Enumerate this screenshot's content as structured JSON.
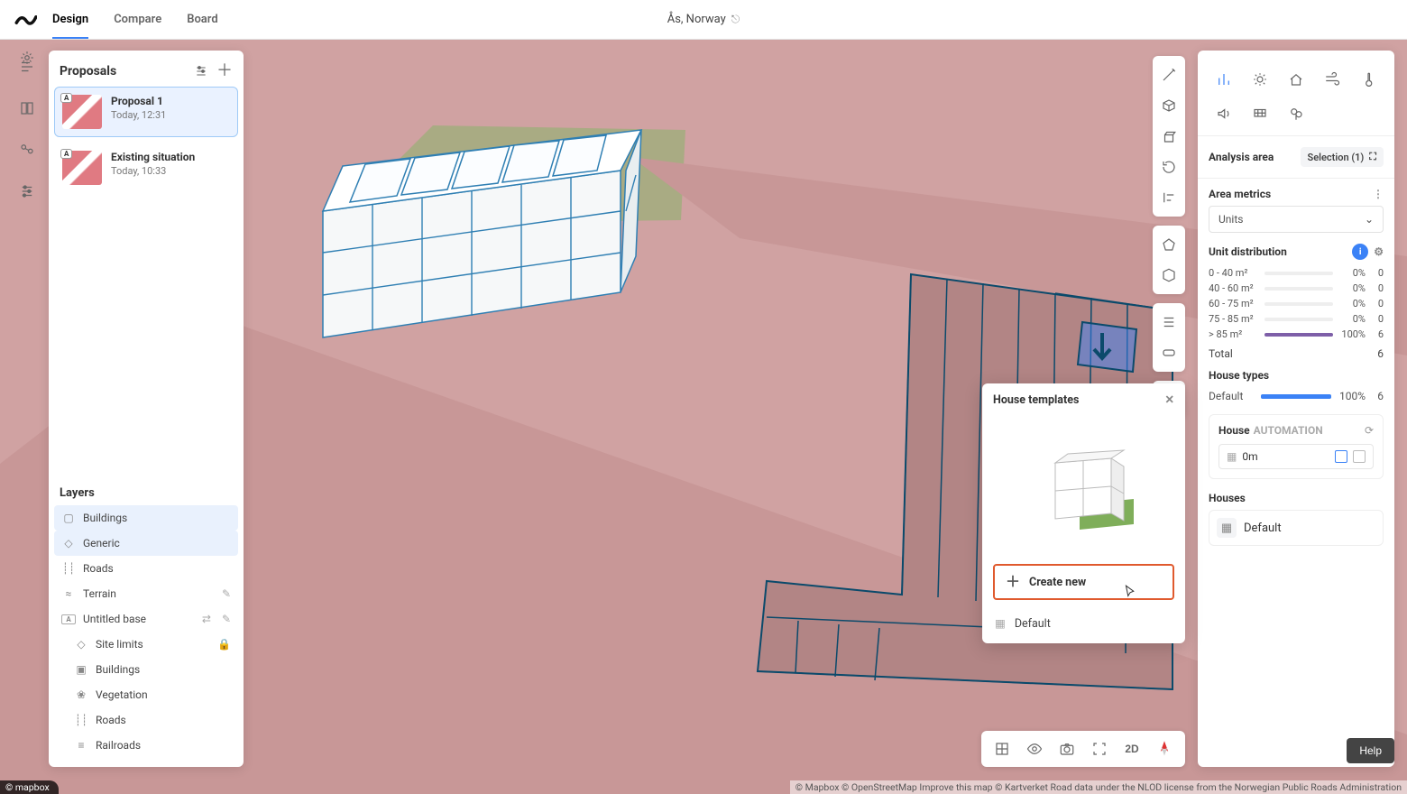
{
  "header": {
    "tabs": {
      "design": "Design",
      "compare": "Compare",
      "board": "Board"
    },
    "location": "Ås, Norway"
  },
  "proposals": {
    "title": "Proposals",
    "items": [
      {
        "title": "Proposal 1",
        "time": "Today, 12:31",
        "badge": "A",
        "selected": true
      },
      {
        "title": "Existing situation",
        "time": "Today, 10:33",
        "badge": "A",
        "selected": false
      }
    ]
  },
  "layers": {
    "title": "Layers",
    "items": [
      {
        "label": "Buildings",
        "selected": true,
        "action": ""
      },
      {
        "label": "Generic",
        "selected": true,
        "action": ""
      },
      {
        "label": "Roads",
        "selected": false,
        "action": ""
      },
      {
        "label": "Terrain",
        "selected": false,
        "action": "edit"
      },
      {
        "label": "Untitled base",
        "selected": false,
        "action": "swap-edit",
        "badge": "A"
      },
      {
        "label": "Site limits",
        "selected": false,
        "indent": true,
        "action": "lock"
      },
      {
        "label": "Buildings",
        "selected": false,
        "indent": true,
        "action": ""
      },
      {
        "label": "Vegetation",
        "selected": false,
        "indent": true,
        "action": ""
      },
      {
        "label": "Roads",
        "selected": false,
        "indent": true,
        "action": ""
      },
      {
        "label": "Railroads",
        "selected": false,
        "indent": true,
        "action": ""
      }
    ]
  },
  "analysis": {
    "area_label": "Analysis area",
    "selection_label": "Selection (1)",
    "metrics_label": "Area metrics",
    "units_selector": "Units",
    "unit_dist_label": "Unit distribution",
    "unit_dist_badge": "i",
    "rows": [
      {
        "range": "0 - 40 m²",
        "pct": "0%",
        "count": "0",
        "fill": 0,
        "color": "#7aa7ff"
      },
      {
        "range": "40 - 60 m²",
        "pct": "0%",
        "count": "0",
        "fill": 0,
        "color": "#7aa7ff"
      },
      {
        "range": "60 - 75 m²",
        "pct": "0%",
        "count": "0",
        "fill": 0,
        "color": "#7aa7ff"
      },
      {
        "range": "75 - 85 m²",
        "pct": "0%",
        "count": "0",
        "fill": 0,
        "color": "#7aa7ff"
      },
      {
        "range": "> 85 m²",
        "pct": "100%",
        "count": "6",
        "fill": 100,
        "color": "#7e5fa8"
      }
    ],
    "total_label": "Total",
    "total_count": "6",
    "house_types_label": "House types",
    "house_type": {
      "name": "Default",
      "pct": "100%",
      "count": "6"
    },
    "automation_label": "House",
    "automation_tag": "AUTOMATION",
    "automation_value": "0m",
    "houses_label": "Houses",
    "house_row_label": "Default"
  },
  "templates": {
    "title": "House templates",
    "create_label": "Create new",
    "default_label": "Default"
  },
  "view": {
    "mode2d": "2D"
  },
  "help": "Help",
  "attribution_left": "© mapbox",
  "attribution": "© Mapbox © OpenStreetMap Improve this map © Kartverket Road data under the NLOD license from the Norwegian Public Roads Administration"
}
